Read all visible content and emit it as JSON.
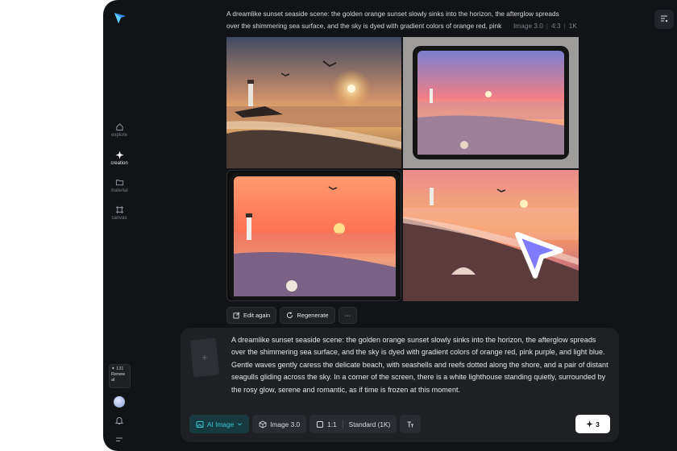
{
  "sidebar": {
    "items": [
      {
        "label": "explore",
        "icon": "home-icon"
      },
      {
        "label": "creation",
        "icon": "sparkle-icon"
      },
      {
        "label": "material",
        "icon": "folder-icon"
      },
      {
        "label": "canvas",
        "icon": "canvas-icon"
      }
    ],
    "renew": {
      "points": "✦ 131",
      "label": "Renew al"
    }
  },
  "header": {
    "prompt_line1": "A dreamlike sunset seaside scene: the golden orange sunset slowly sinks into the horizon, the afterglow spreads",
    "prompt_line2": "over the shimmering sea surface, and the sky is dyed with gradient colors of orange red, pink",
    "meta": {
      "model": "Image 3.0",
      "ratio": "4:3",
      "resolution": "1K"
    }
  },
  "actions": {
    "edit_again": "Edit again",
    "regenerate": "Regenerate",
    "more": "···"
  },
  "composer": {
    "prompt": "A dreamlike sunset seaside scene: the golden orange sunset slowly sinks into the horizon, the afterglow spreads over the shimmering sea surface, and the sky is dyed with gradient colors of orange red, pink purple, and light blue. Gentle waves gently caress the delicate beach, with seashells and reefs dotted along the shore, and a pair of distant seagulls gliding across the sky. In a corner of the screen, there is a white lighthouse standing quietly, surrounded by the rosy glow, serene and romantic, as if time is frozen at this moment.",
    "add_ref": "+",
    "tools": {
      "mode": "AI Image",
      "model": "Image 3.0",
      "ratio": "1:1",
      "quality": "Standard (1K)"
    },
    "send_cost": "3"
  },
  "colors": {
    "accent": "#37c9d6",
    "background": "#121316",
    "panel": "#1e2024"
  }
}
